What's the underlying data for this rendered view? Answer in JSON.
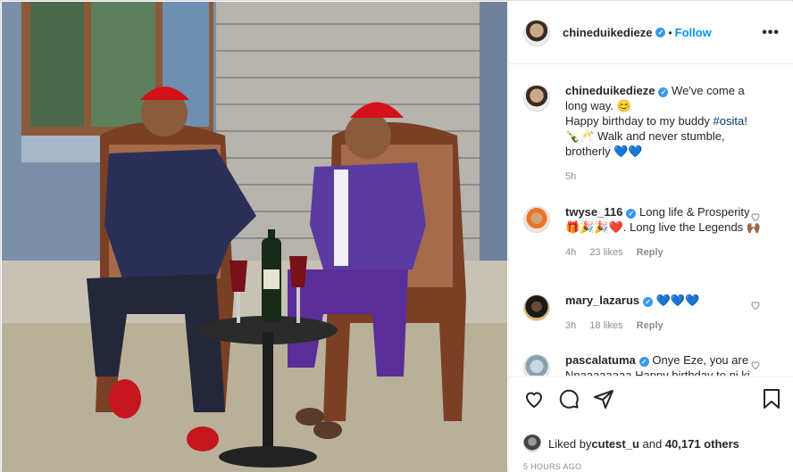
{
  "post": {
    "username": "chineduikedieze",
    "follow_label": "Follow",
    "more_icon": "more-icon",
    "dot": "•"
  },
  "caption": {
    "username": "chineduikedieze",
    "text_1": "We've come a long way. 😊",
    "text_2": "Happy birthday to my buddy ",
    "hashtag": "#osita",
    "text_3": "!",
    "text_4": "🍾🥂 Walk and never stumble, brotherly 💙💙",
    "time": "5h"
  },
  "comments": [
    {
      "username": "twyse_116",
      "text": "Long life & Prosperity 🎁🎉🎉❤️. Long live the Legends 🙌🏾",
      "time": "4h",
      "likes": "23 likes",
      "reply": "Reply"
    },
    {
      "username": "mary_lazarus",
      "text": "💙💙💙",
      "time": "3h",
      "likes": "18 likes",
      "reply": "Reply"
    },
    {
      "username": "pascalatuma",
      "text": "Onye Eze, you are Nnaaaaaaaa Happy birthday to ni ki",
      "time": "",
      "likes": "",
      "reply": ""
    }
  ],
  "footer": {
    "liked_by_prefix": "Liked by ",
    "liked_by_user": "cutest_u",
    "liked_by_mid": " and ",
    "liked_by_count": "40,171 others",
    "timestamp": "5 HOURS AGO"
  },
  "colors": {
    "link_blue": "#0095f6",
    "verified_blue": "#3897f0",
    "muted": "#8e8e8e"
  }
}
